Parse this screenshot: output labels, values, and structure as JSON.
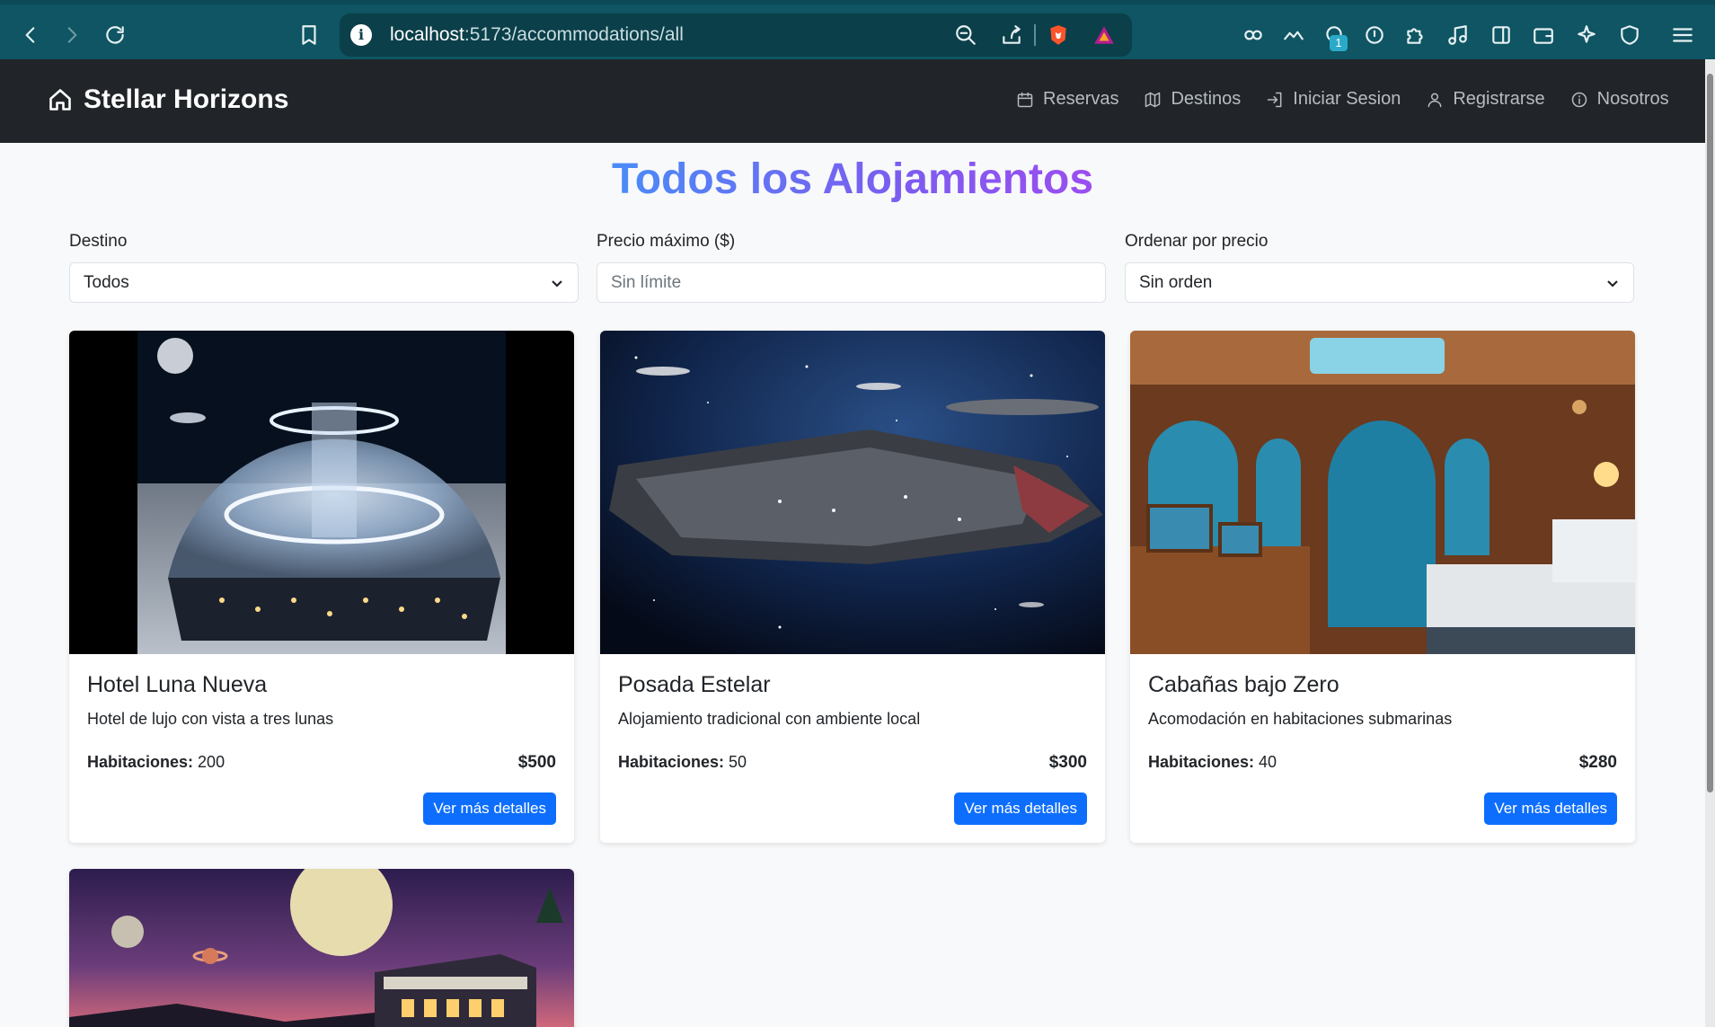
{
  "browser": {
    "url_host": "localhost",
    "url_path": ":5173/accommodations/all",
    "extension_badge": "1"
  },
  "navbar": {
    "brand": "Stellar Horizons",
    "links": [
      {
        "label": "Reservas",
        "icon": "calendar-icon"
      },
      {
        "label": "Destinos",
        "icon": "map-icon"
      },
      {
        "label": "Iniciar Sesion",
        "icon": "login-icon"
      },
      {
        "label": "Registrarse",
        "icon": "user-icon"
      },
      {
        "label": "Nosotros",
        "icon": "info-icon"
      }
    ]
  },
  "page": {
    "title": "Todos los Alojamientos"
  },
  "filters": {
    "destination": {
      "label": "Destino",
      "value": "Todos"
    },
    "max_price": {
      "label": "Precio máximo ($)",
      "placeholder": "Sin límite"
    },
    "sort": {
      "label": "Ordenar por precio",
      "value": "Sin orden"
    }
  },
  "accommodations": [
    {
      "name": "Hotel Luna Nueva",
      "description": "Hotel de lujo con vista a tres lunas",
      "rooms_label": "Habitaciones:",
      "rooms": "200",
      "price": "$500",
      "button": "Ver más detalles",
      "image": "lunar-dome-hotel"
    },
    {
      "name": "Posada Estelar",
      "description": "Alojamiento tradicional con ambiente local",
      "rooms_label": "Habitaciones:",
      "rooms": "50",
      "price": "$300",
      "button": "Ver más detalles",
      "image": "spaceship-in-space"
    },
    {
      "name": "Cabañas bajo Zero",
      "description": "Acomodación en habitaciones submarinas",
      "rooms_label": "Habitaciones:",
      "rooms": "40",
      "price": "$280",
      "button": "Ver más detalles",
      "image": "underwater-room"
    },
    {
      "image": "night-moon-lodge"
    }
  ]
}
